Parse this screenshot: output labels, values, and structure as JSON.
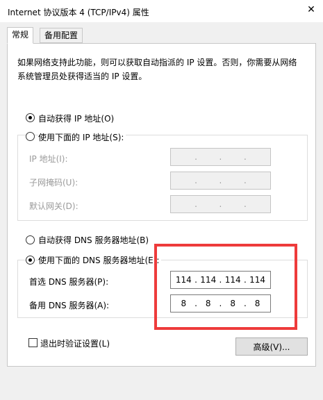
{
  "window": {
    "title": "Internet 协议版本 4 (TCP/IPv4) 属性",
    "close_glyph": "✕"
  },
  "tabs": [
    {
      "label": "常规",
      "active": true
    },
    {
      "label": "备用配置",
      "active": false
    }
  ],
  "description": "如果网络支持此功能，则可以获取自动指派的 IP 设置。否则，你需要从网络系统管理员处获得适当的 IP 设置。",
  "ip": {
    "auto_label": "自动获得 IP 地址(O)",
    "auto_checked": true,
    "manual_label": "使用下面的 IP 地址(S):",
    "manual_checked": false,
    "fields": [
      {
        "label": "IP 地址(I):",
        "octets": [
          "",
          "",
          "",
          ""
        ]
      },
      {
        "label": "子网掩码(U):",
        "octets": [
          "",
          "",
          "",
          ""
        ]
      },
      {
        "label": "默认网关(D):",
        "octets": [
          "",
          "",
          "",
          ""
        ]
      }
    ]
  },
  "dns": {
    "auto_label": "自动获得 DNS 服务器地址(B)",
    "auto_checked": false,
    "manual_label": "使用下面的 DNS 服务器地址(E):",
    "manual_checked": true,
    "fields": [
      {
        "label": "首选 DNS 服务器(P):",
        "octets": [
          "114",
          "114",
          "114",
          "114"
        ]
      },
      {
        "label": "备用 DNS 服务器(A):",
        "octets": [
          "8",
          "8",
          "8",
          "8"
        ]
      }
    ]
  },
  "validate": {
    "label": "退出时验证设置(L)",
    "checked": false
  },
  "advanced_button": "高级(V)...",
  "colors": {
    "highlight_box": "#ee3b3b",
    "panel": "#ffffff",
    "background": "#f0f0f0"
  }
}
